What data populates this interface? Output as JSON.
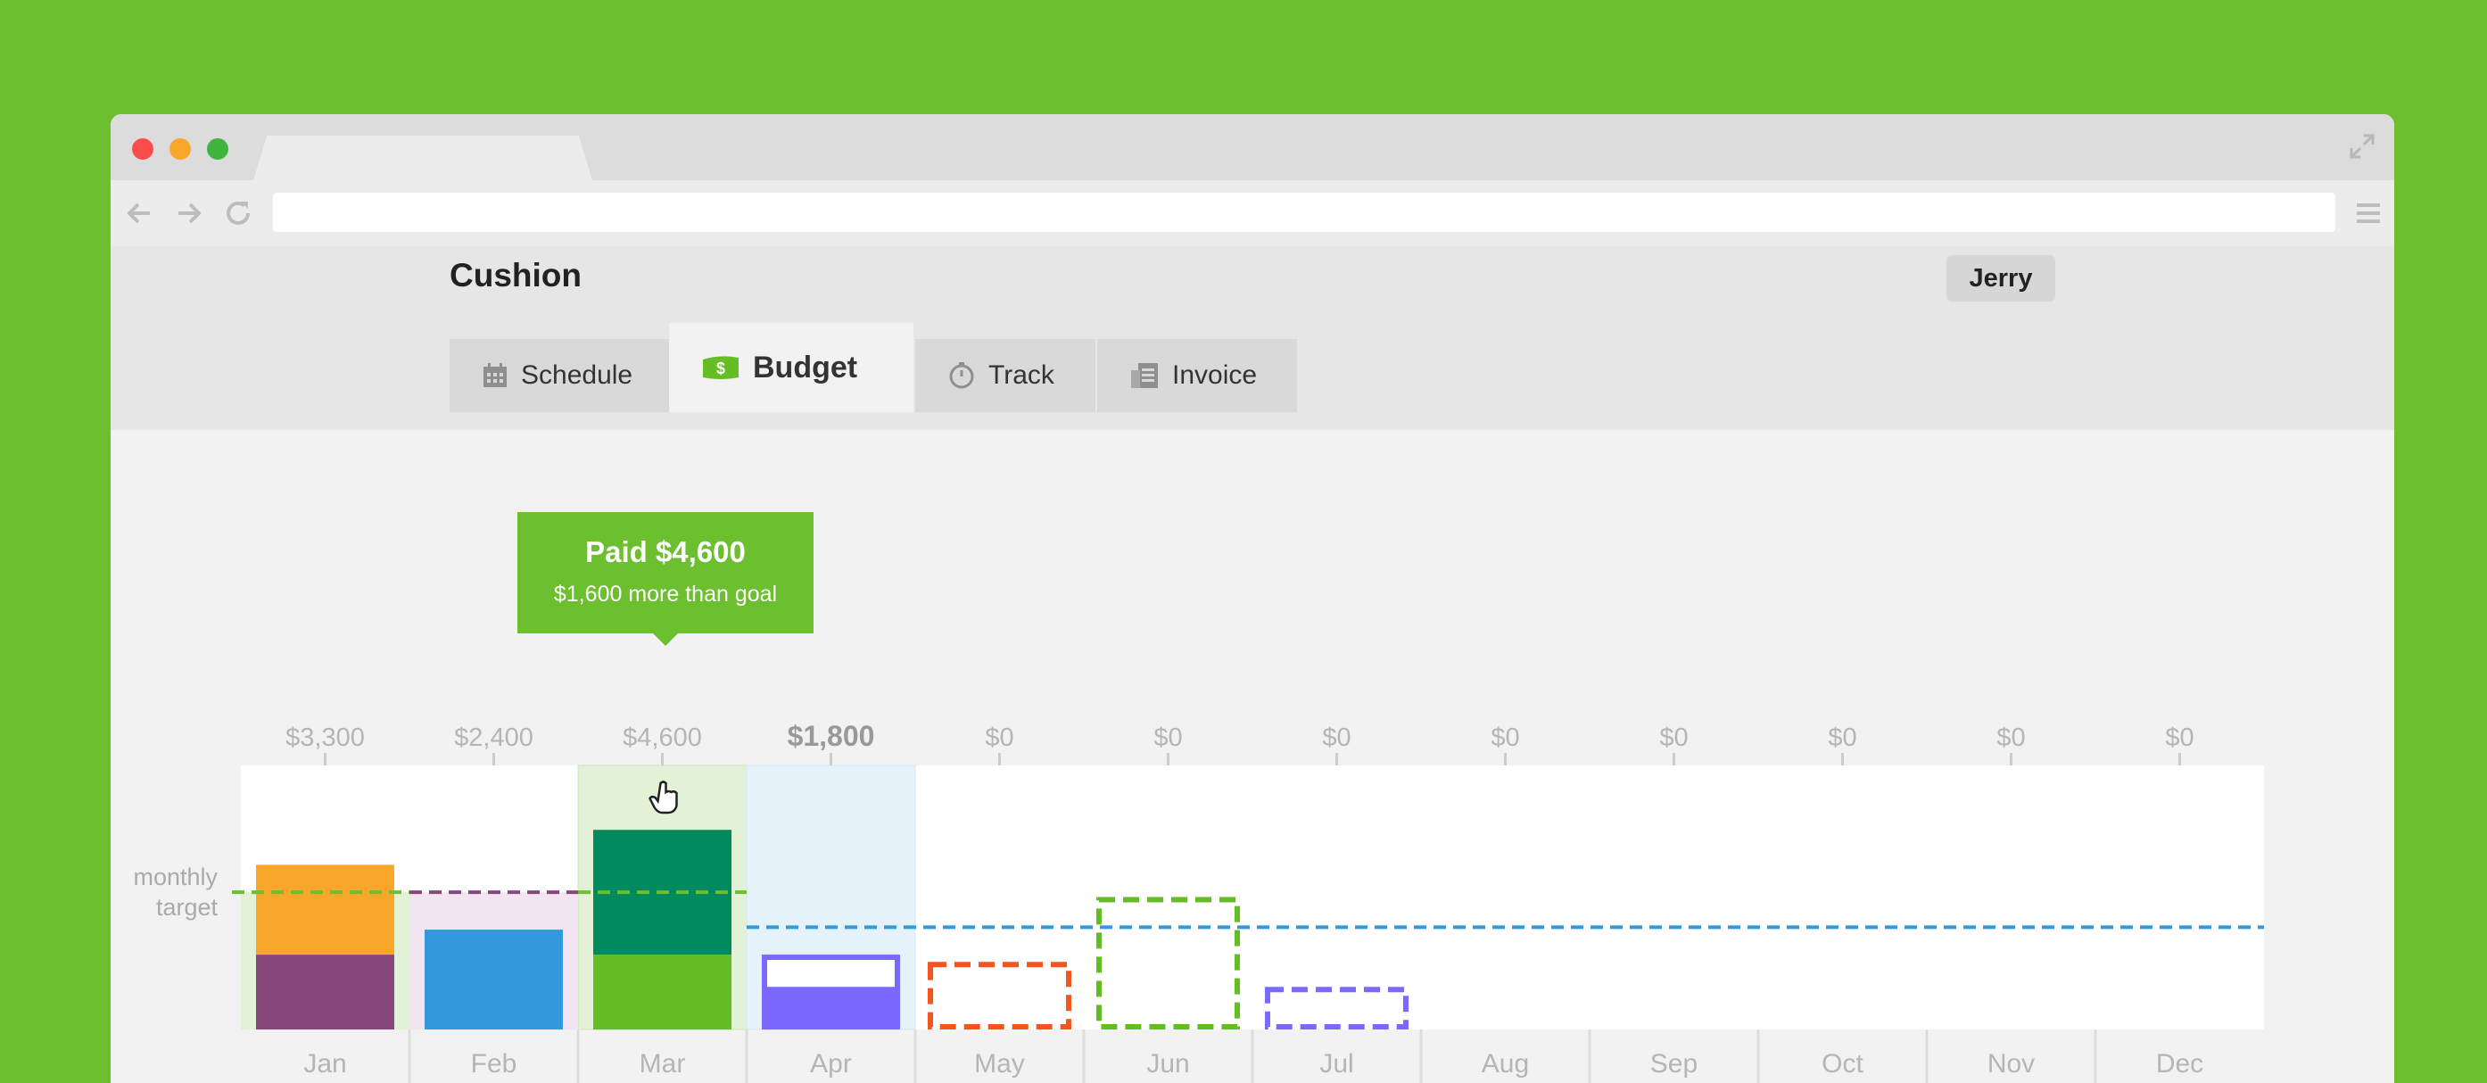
{
  "app": {
    "name": "Cushion",
    "user": "Jerry"
  },
  "tabs": [
    {
      "label": "Schedule",
      "icon": "calendar-icon",
      "active": false
    },
    {
      "label": "Budget",
      "icon": "money-icon",
      "active": true
    },
    {
      "label": "Track",
      "icon": "stopwatch-icon",
      "active": false
    },
    {
      "label": "Invoice",
      "icon": "invoice-icon",
      "active": false
    }
  ],
  "tooltip": {
    "title": "Paid $4,600",
    "subtitle": "$1,600 more than goal"
  },
  "target_label": "monthly target",
  "colors": {
    "brand_green": "#6cbf2e",
    "orange": "#f9a72b",
    "purple": "#86487b",
    "blue": "#3399dd",
    "dark_green": "#008a5e",
    "green": "#64bd23",
    "violet": "#7b68ff",
    "red_orange": "#f4551c"
  },
  "chart_data": {
    "type": "bar",
    "categories": [
      "Jan",
      "Feb",
      "Mar",
      "Apr",
      "May",
      "Jun",
      "Jul",
      "Aug",
      "Sep",
      "Oct",
      "Nov",
      "Dec"
    ],
    "top_labels": [
      "$3,300",
      "$2,400",
      "$4,600",
      "$1,800",
      "$0",
      "$0",
      "$0",
      "$0",
      "$0",
      "$0",
      "$0",
      "$0"
    ],
    "ylim": [
      0,
      5000
    ],
    "targets": [
      {
        "from": "Jan",
        "to": "Jan",
        "value": 2750,
        "color": "#6cbf2e",
        "style": "dashed"
      },
      {
        "from": "Feb",
        "to": "Feb",
        "value": 2750,
        "color": "#86487b",
        "style": "dashed"
      },
      {
        "from": "Mar",
        "to": "Mar",
        "value": 2750,
        "color": "#6cbf2e",
        "style": "dashed"
      },
      {
        "from": "Apr",
        "to": "Dec",
        "value": 2050,
        "color": "#3399dd",
        "style": "dashed"
      }
    ],
    "bars": [
      {
        "month": "Jan",
        "segments": [
          {
            "value": 1500,
            "color": "#86487b"
          },
          {
            "value": 1800,
            "color": "#f9a72b"
          }
        ],
        "style": "solid"
      },
      {
        "month": "Feb",
        "segments": [
          {
            "value": 2000,
            "color": "#3399dd"
          }
        ],
        "style": "solid"
      },
      {
        "month": "Mar",
        "segments": [
          {
            "value": 1500,
            "color": "#64bd23"
          },
          {
            "value": 2500,
            "color": "#008a5e"
          }
        ],
        "style": "solid"
      },
      {
        "month": "Apr",
        "segments": [
          {
            "value": 800,
            "color": "#7b68ff"
          },
          {
            "value": 700,
            "color": "#7b68ff",
            "hollow": true
          }
        ],
        "style": "solid"
      },
      {
        "month": "May",
        "segments": [
          {
            "value": 1300,
            "color": "#f4551c"
          }
        ],
        "style": "dashed"
      },
      {
        "month": "Jun",
        "segments": [
          {
            "value": 2600,
            "color": "#64bd23"
          }
        ],
        "style": "dashed"
      },
      {
        "month": "Jul",
        "segments": [
          {
            "value": 800,
            "color": "#7b68ff"
          }
        ],
        "style": "dashed"
      }
    ],
    "highlighted": [
      "Mar"
    ],
    "current": "Apr"
  }
}
